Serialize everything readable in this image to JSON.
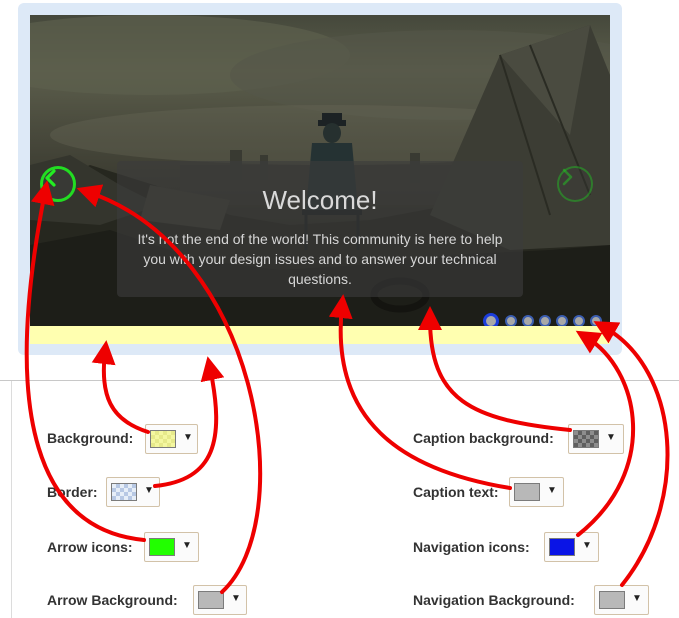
{
  "slider": {
    "caption_title": "Welcome!",
    "caption_text": "It's not the end of the world!  This community is here to help you with your design issues and to answer your technical questions.",
    "nav_dot_count": 7,
    "active_dot": 0
  },
  "options": {
    "background": {
      "label": "Background:",
      "swatch": "checker-yellow"
    },
    "border": {
      "label": "Border:",
      "swatch": "checker-blue"
    },
    "arrow_icons": {
      "label": "Arrow icons:",
      "color": "#22ff00"
    },
    "arrow_background": {
      "label": "Arrow Background:",
      "color": "#b8b8b8"
    },
    "caption_background": {
      "label": "Caption background:",
      "swatch": "checker-dark"
    },
    "caption_text": {
      "label": "Caption text:",
      "color": "#b8b8b8"
    },
    "navigation_icons": {
      "label": "Navigation icons:",
      "color": "#0a14e6"
    },
    "navigation_background": {
      "label": "Navigation Background:",
      "color": "#b8b8b8"
    }
  },
  "colors": {
    "annotation_arrow": "#ee0000",
    "arrow_icon_green": "#22dd22",
    "panel_bg": "#dde9f7",
    "yellow_strip": "#ffffb0"
  },
  "icons": {
    "prev": "chevron-left-icon",
    "next": "chevron-right-icon",
    "caret": "caret-down-icon"
  }
}
